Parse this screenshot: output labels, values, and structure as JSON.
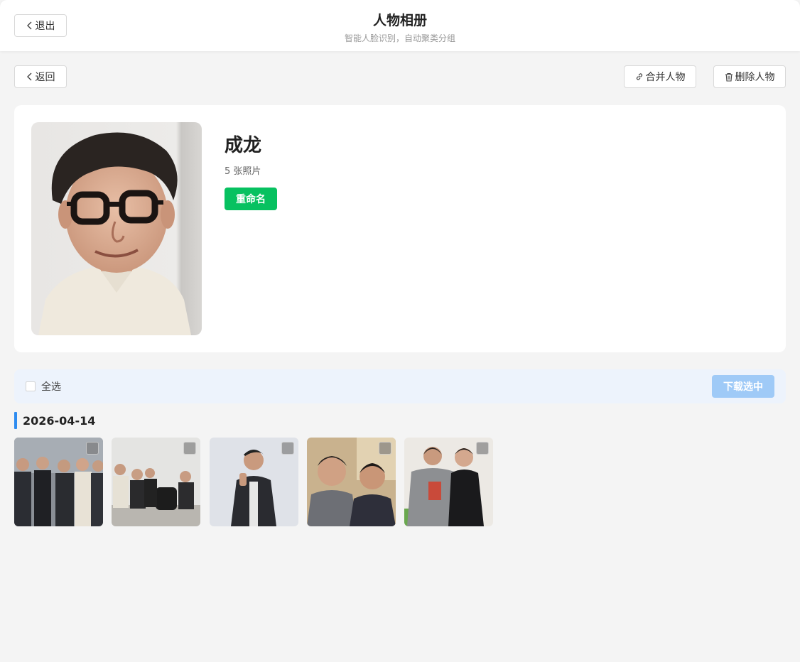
{
  "header": {
    "exit_label": "退出",
    "title": "人物相册",
    "subtitle": "智能人脸识别，自动聚类分组"
  },
  "toolbar": {
    "back_label": "返回",
    "merge_label": "合并人物",
    "delete_label": "删除人物"
  },
  "person": {
    "name": "成龙",
    "photo_count": "5 张照片",
    "rename_label": "重命名"
  },
  "selection": {
    "select_all_label": "全选",
    "select_all_checked": false,
    "download_label": "下载选中"
  },
  "groups": [
    {
      "date": "2026-04-14",
      "photos": [
        {
          "selected": false
        },
        {
          "selected": false
        },
        {
          "selected": false
        },
        {
          "selected": false
        },
        {
          "selected": false
        }
      ]
    }
  ],
  "colors": {
    "accent_green": "#07c160",
    "accent_blue": "#2e8cf0",
    "download_disabled": "#9fcaf7",
    "select_bar_bg": "#edf3fc"
  }
}
